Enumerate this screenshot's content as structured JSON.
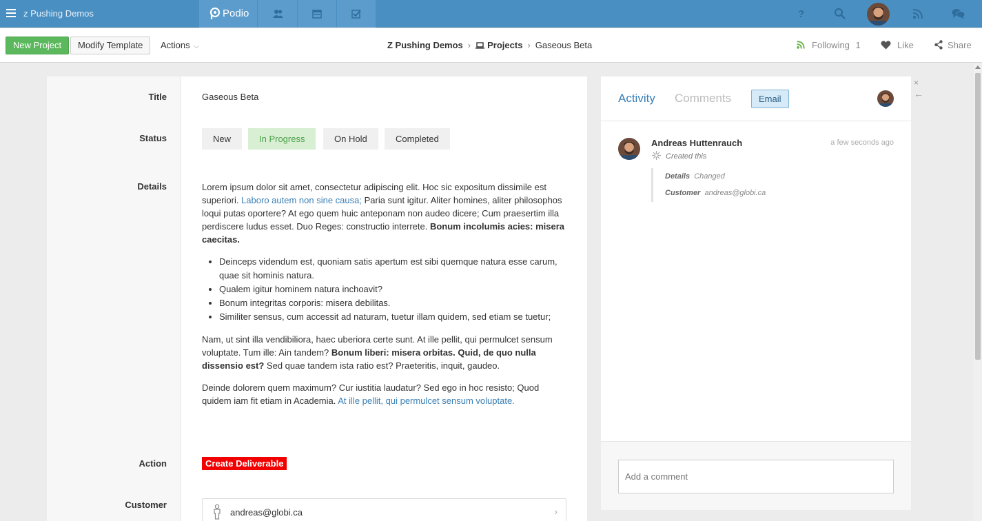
{
  "topbar": {
    "workspace": "z Pushing Demos",
    "brand": "Podio",
    "accent": "#4a8fc2",
    "apps": [
      "contacts-icon",
      "calendar-icon",
      "tasks-icon"
    ],
    "right_icons": [
      "help-icon",
      "search-icon",
      "avatar",
      "feed-icon",
      "chat-icon"
    ]
  },
  "subbar": {
    "new_label": "New Project",
    "modify_label": "Modify Template",
    "actions_label": "Actions",
    "breadcrumb": {
      "workspace": "Z Pushing Demos",
      "app": "Projects",
      "item": "Gaseous Beta"
    },
    "following_label": "Following",
    "following_count": "1",
    "like_label": "Like",
    "share_label": "Share"
  },
  "fields": {
    "title_label": "Title",
    "title_value": "Gaseous Beta",
    "status_label": "Status",
    "status_options": [
      "New",
      "In Progress",
      "On Hold",
      "Completed"
    ],
    "status_selected": "In Progress",
    "details_label": "Details",
    "details": {
      "p1_a": "Lorem ipsum dolor sit amet, consectetur adipiscing elit. Hoc sic expositum dissimile est superiori. ",
      "p1_link": "Laboro autem non sine causa;",
      "p1_b": " Paria sunt igitur. Aliter homines, aliter philosophos loqui putas oportere? At ego quem huic anteponam non audeo dicere; Cum praesertim illa perdiscere ludus esset. Duo Reges: constructio interrete. ",
      "p1_bold": "Bonum incolumis acies: misera caecitas.",
      "list": [
        "Deinceps videndum est, quoniam satis apertum est sibi quemque natura esse carum, quae sit hominis natura.",
        "Qualem igitur hominem natura inchoavit?",
        "Bonum integritas corporis: misera debilitas.",
        "Similiter sensus, cum accessit ad naturam, tuetur illam quidem, sed etiam se tuetur;"
      ],
      "p2_a": "Nam, ut sint illa vendibiliora, haec uberiora certe sunt. At ille pellit, qui permulcet sensum voluptate. Tum ille: Ain tandem? ",
      "p2_bold": "Bonum liberi: misera orbitas. Quid, de quo nulla dissensio est?",
      "p2_b": " Sed quae tandem ista ratio est? Praeteritis, inquit, gaudeo.",
      "p3_a": "Deinde dolorem quem maximum? Cur iustitia laudatur? Sed ego in hoc resisto; Quod quidem iam fit etiam in Academia. ",
      "p3_link": "At ille pellit, qui permulcet sensum voluptate."
    },
    "action_label": "Action",
    "action_button": "Create Deliverable",
    "customer_label": "Customer",
    "customer_value": "andreas@globi.ca"
  },
  "activity": {
    "tab_activity": "Activity",
    "tab_comments": "Comments",
    "email_label": "Email",
    "entry": {
      "user": "Andreas Huttenrauch",
      "time": "a few seconds ago",
      "action": "Created this",
      "changes": [
        {
          "field": "Details",
          "value": "Changed"
        },
        {
          "field": "Customer",
          "value": "andreas@globi.ca"
        }
      ]
    },
    "comment_placeholder": "Add a comment"
  }
}
